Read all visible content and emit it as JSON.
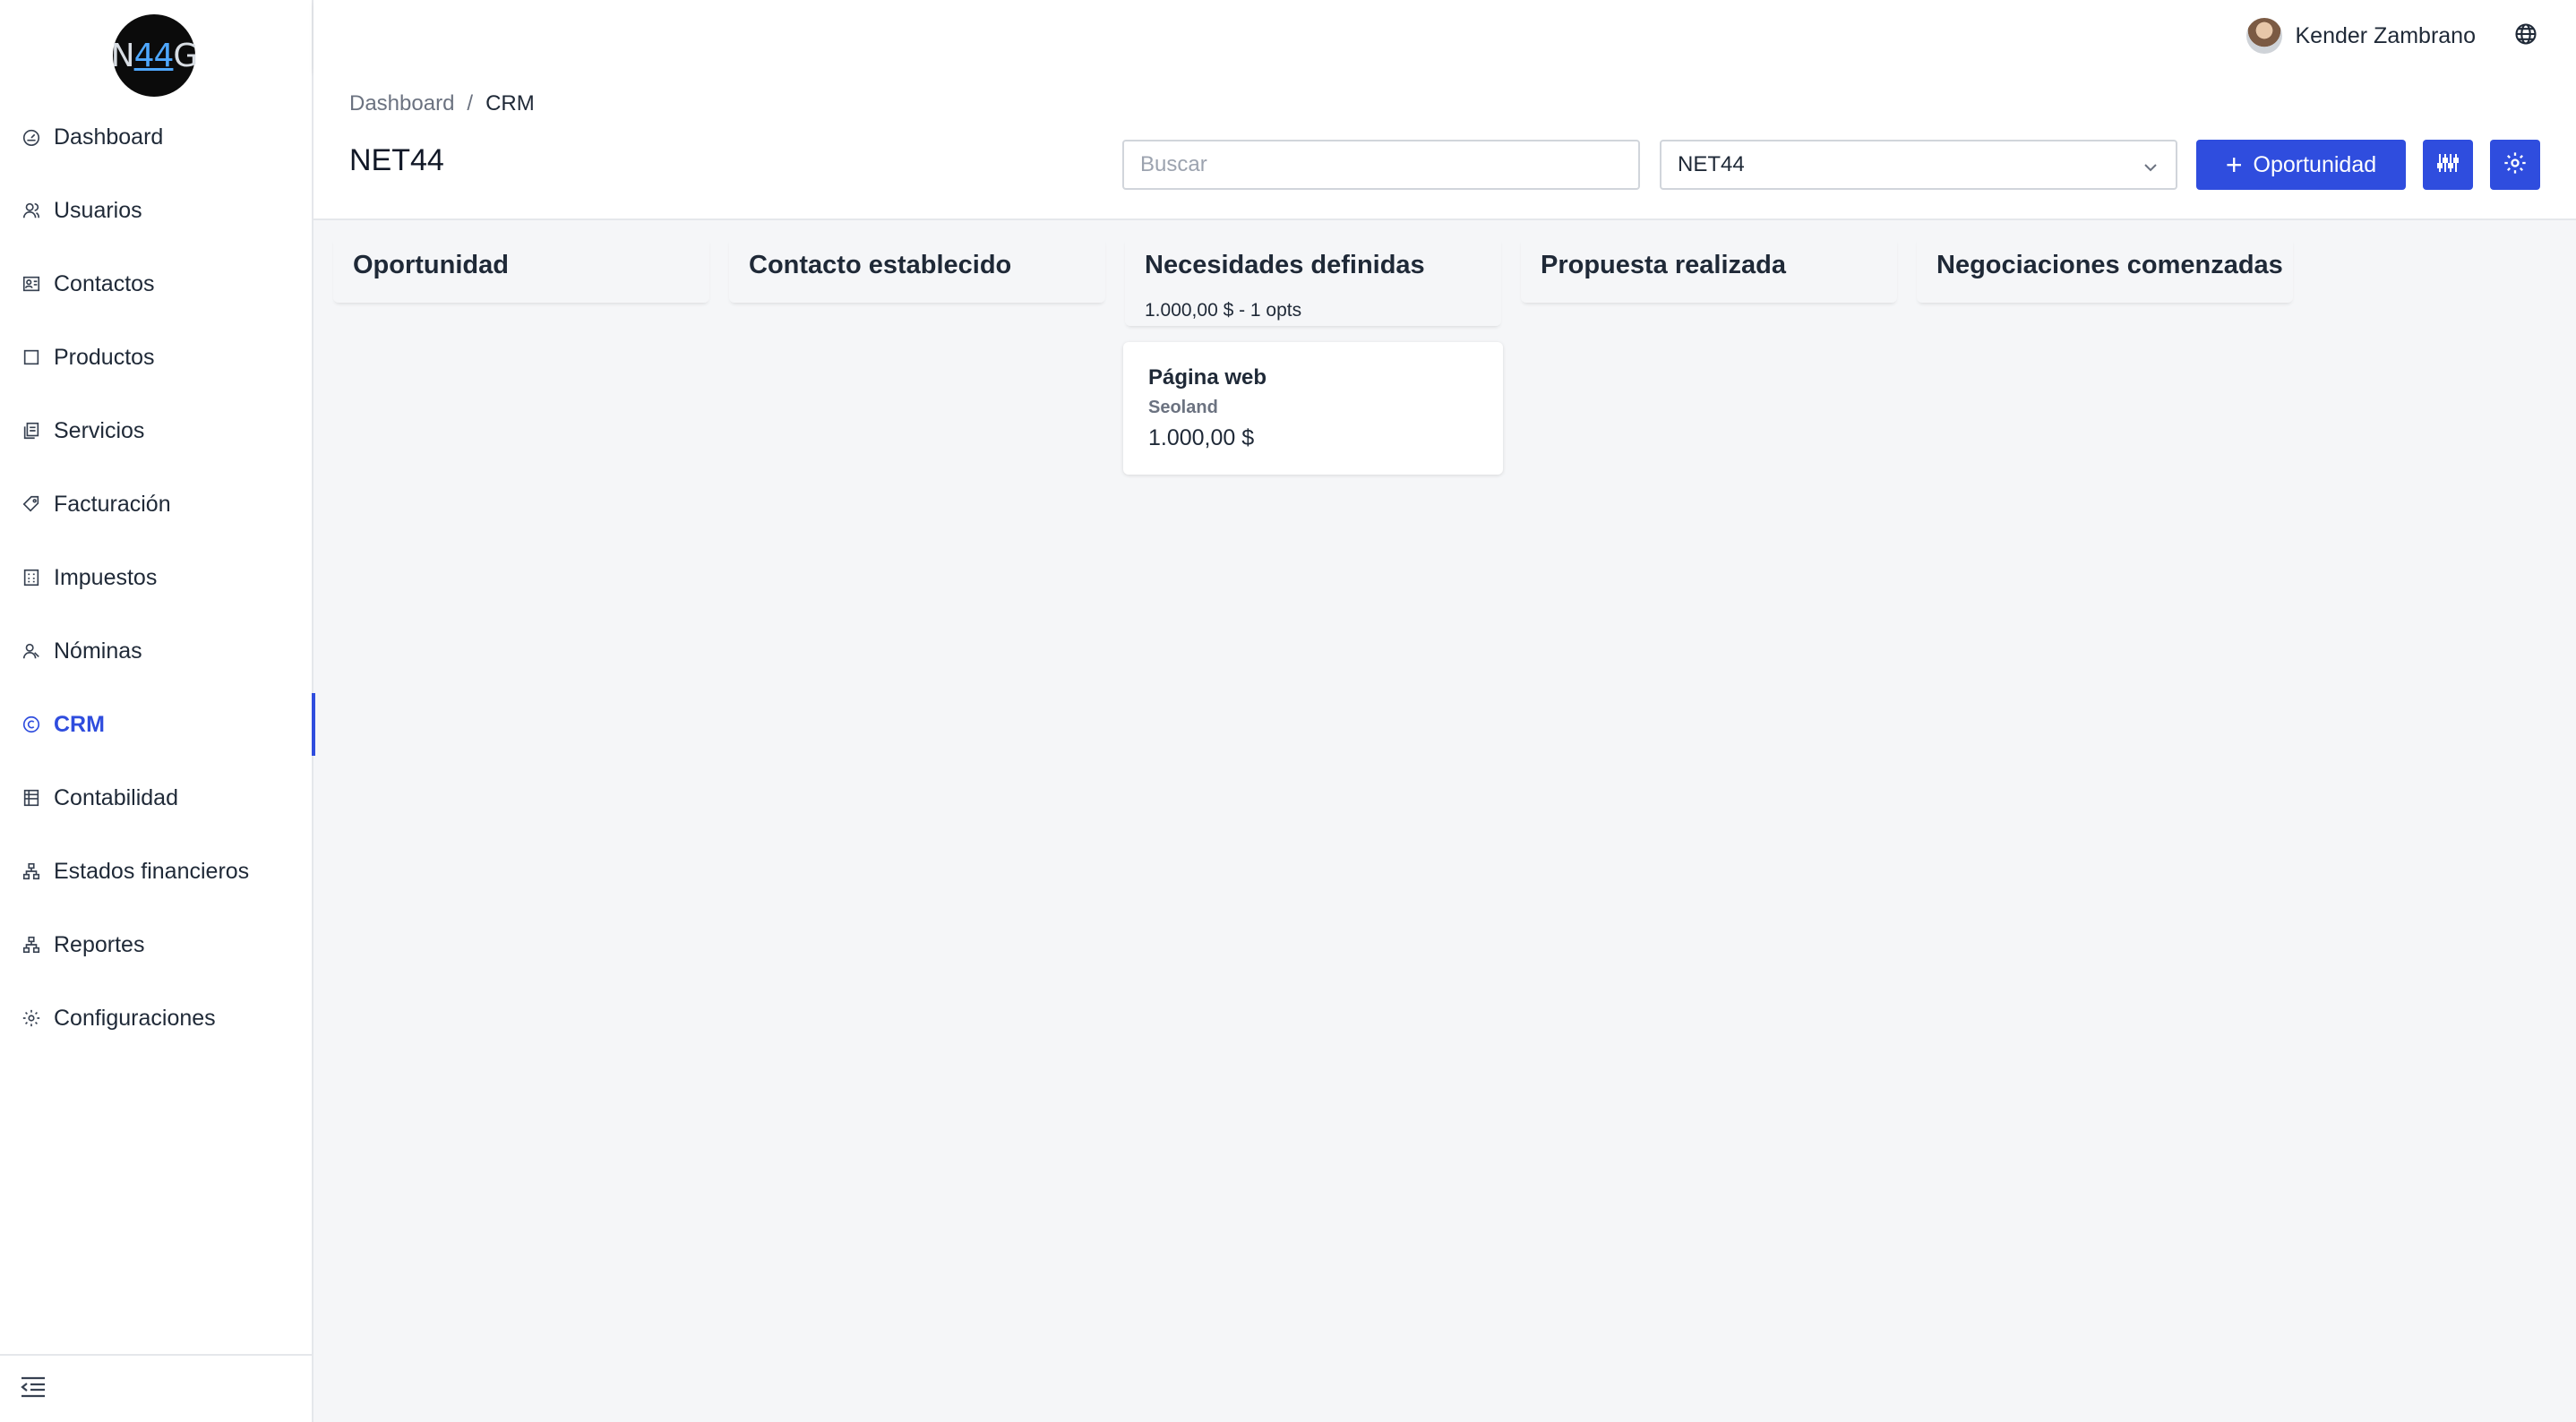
{
  "brand": {
    "logo_prefix": "N",
    "logo_accent": "44",
    "logo_suffix": "G"
  },
  "sidebar": {
    "items": [
      {
        "label": "Dashboard",
        "icon": "dashboard-icon",
        "active": false
      },
      {
        "label": "Usuarios",
        "icon": "users-icon",
        "active": false
      },
      {
        "label": "Contactos",
        "icon": "contacts-icon",
        "active": false
      },
      {
        "label": "Productos",
        "icon": "products-icon",
        "active": false
      },
      {
        "label": "Servicios",
        "icon": "services-icon",
        "active": false
      },
      {
        "label": "Facturación",
        "icon": "tag-icon",
        "active": false
      },
      {
        "label": "Impuestos",
        "icon": "calculator-icon",
        "active": false
      },
      {
        "label": "Nóminas",
        "icon": "payroll-icon",
        "active": false
      },
      {
        "label": "CRM",
        "icon": "copyright-icon",
        "active": true
      },
      {
        "label": "Contabilidad",
        "icon": "ledger-icon",
        "active": false
      },
      {
        "label": "Estados financieros",
        "icon": "hierarchy-icon",
        "active": false
      },
      {
        "label": "Reportes",
        "icon": "hierarchy-icon",
        "active": false
      },
      {
        "label": "Configuraciones",
        "icon": "gear-icon",
        "active": false
      }
    ],
    "collapse_icon": "menu-collapse-icon"
  },
  "topbar": {
    "user_name": "Kender Zambrano",
    "language_icon": "globe-icon"
  },
  "breadcrumb": {
    "root": "Dashboard",
    "separator": "/",
    "current": "CRM"
  },
  "page": {
    "title": "NET44"
  },
  "toolbar": {
    "search_placeholder": "Buscar",
    "search_value": "",
    "company_select": "NET44",
    "add_button_label": "Oportunidad",
    "colors": {
      "primary": "#2f4dde"
    }
  },
  "board": {
    "columns": [
      {
        "title": "Oportunidad",
        "summary": "",
        "cards": []
      },
      {
        "title": "Contacto establecido",
        "summary": "",
        "cards": []
      },
      {
        "title": "Necesidades definidas",
        "summary": "1.000,00 $ - 1 opts",
        "cards": [
          {
            "title": "Página web",
            "company": "Seoland",
            "amount": "1.000,00 $"
          }
        ]
      },
      {
        "title": "Propuesta realizada",
        "summary": "",
        "cards": []
      },
      {
        "title": "Negociaciones comenzadas",
        "summary": "",
        "cards": []
      }
    ]
  }
}
